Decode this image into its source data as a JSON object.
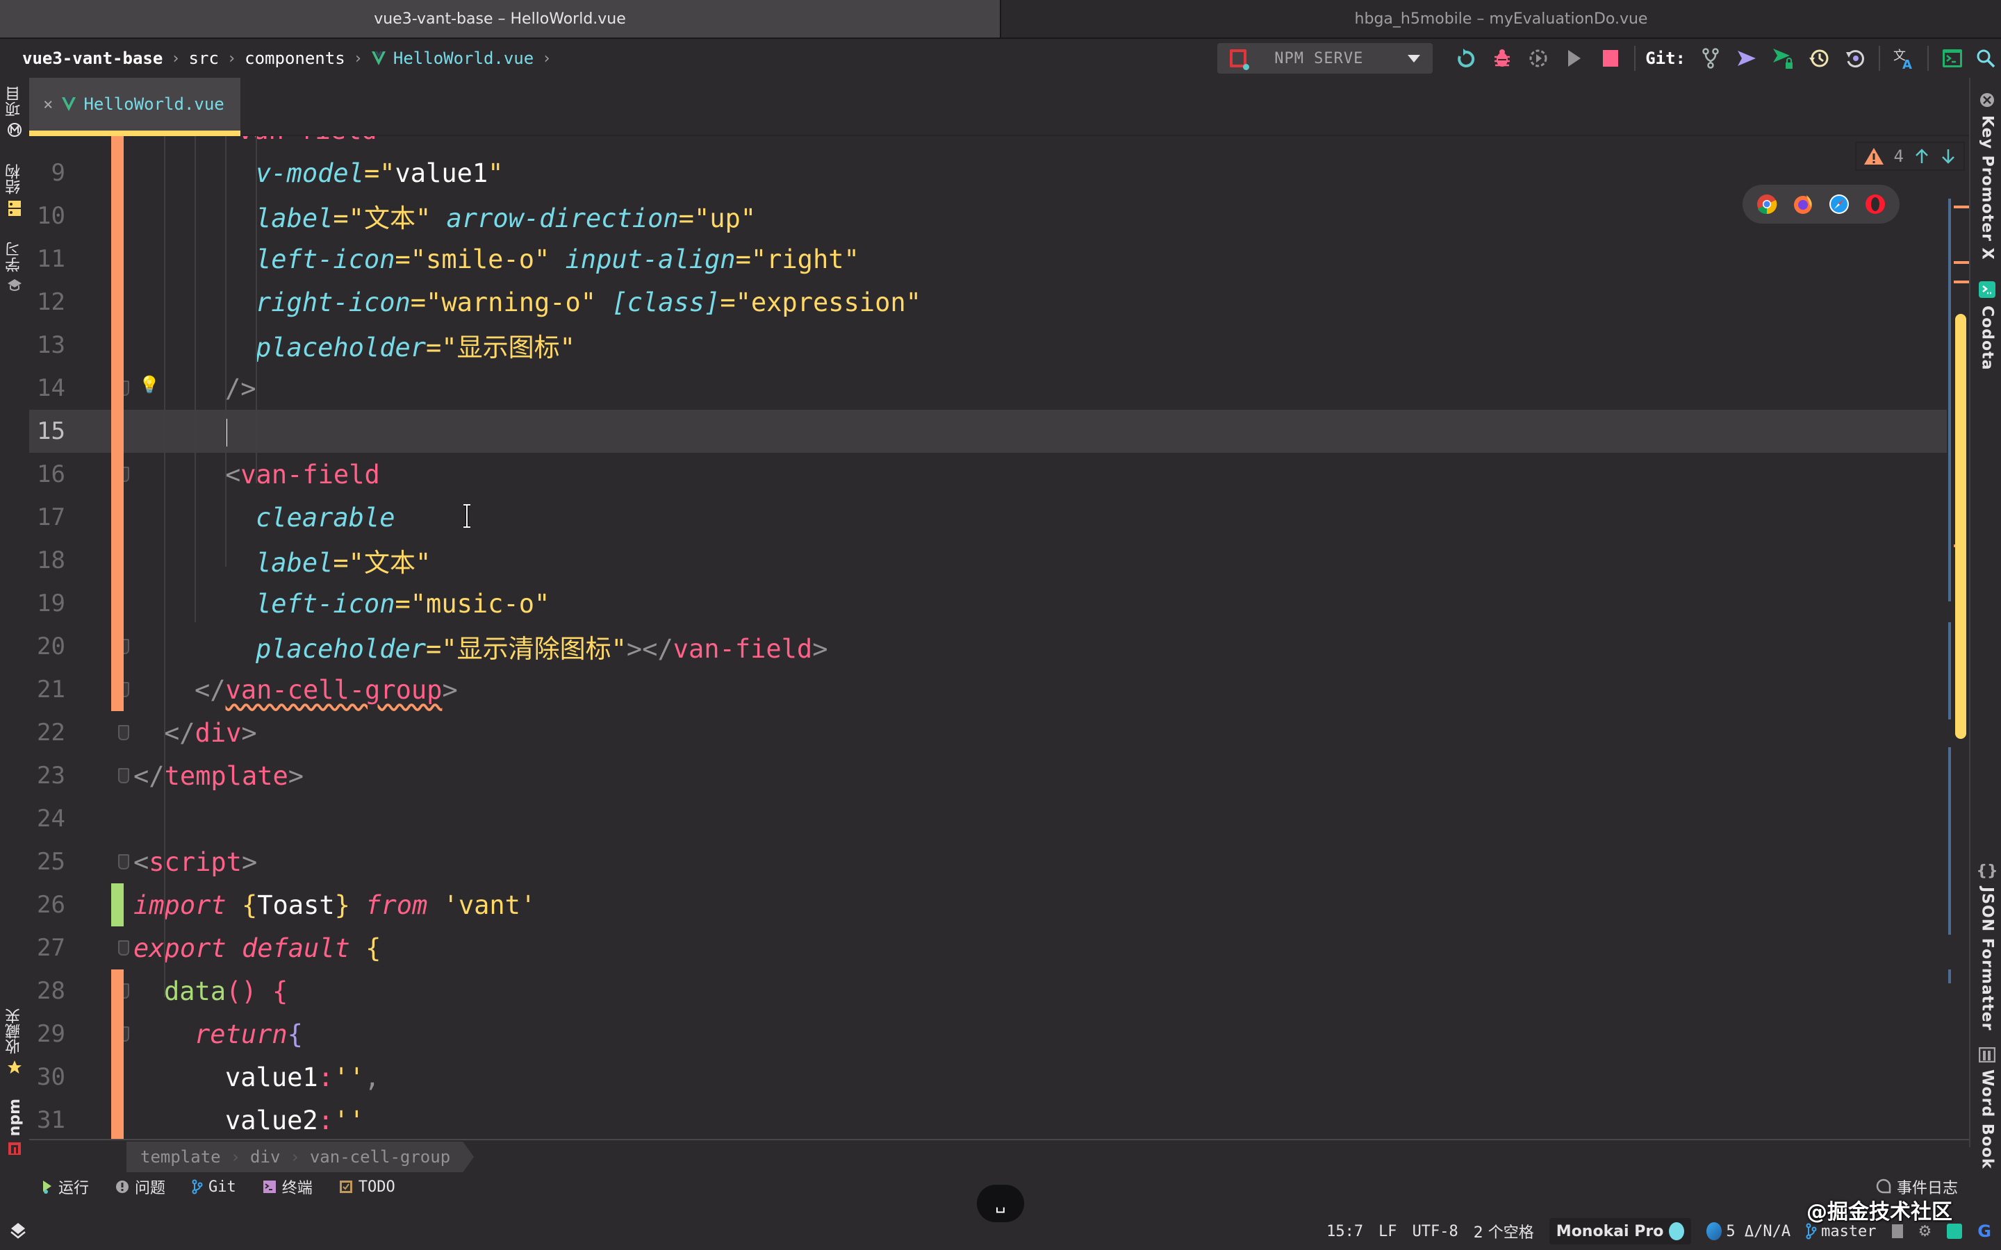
{
  "window_tabs": [
    {
      "title": "vue3-vant-base – HelloWorld.vue",
      "active": true
    },
    {
      "title": "hbga_h5mobile – myEvaluationDo.vue",
      "active": false
    }
  ],
  "breadcrumb": {
    "items": [
      "vue3-vant-base",
      "src",
      "components",
      "HelloWorld.vue"
    ]
  },
  "toolbar": {
    "run_config": "NPM SERVE",
    "git_label": "Git:",
    "icons": [
      "rerun-icon",
      "debug-icon",
      "coverage-icon",
      "run-icon",
      "stop-icon",
      "git-branch-icon",
      "git-push-icon",
      "git-commit-icon",
      "git-history-icon",
      "git-rollback-icon",
      "translate-icon",
      "terminal-icon",
      "search-icon"
    ]
  },
  "left_strip": {
    "top": [
      {
        "label": "项目",
        "icon": "project-icon"
      },
      {
        "label": "结构",
        "icon": "structure-icon"
      },
      {
        "label": "学习",
        "icon": "learn-icon"
      }
    ],
    "bottom": [
      {
        "label": "收藏夹",
        "icon": "star-icon"
      },
      {
        "label": "npm",
        "icon": "npm-icon"
      }
    ]
  },
  "right_strip": [
    {
      "label": "Key Promoter X",
      "icon": "key-promoter-icon"
    },
    {
      "label": "Codota",
      "icon": "codota-icon"
    },
    {
      "label": "JSON Formatter",
      "icon": "braces-icon"
    },
    {
      "label": "Word Book",
      "icon": "book-icon"
    }
  ],
  "editor_tab": {
    "label": "HelloWorld.vue",
    "close": "×"
  },
  "inspections": {
    "warnings": "4"
  },
  "browsers": [
    "chrome",
    "firefox",
    "safari",
    "opera"
  ],
  "editor": {
    "partial_top_line": "van-field",
    "lines": [
      {
        "n": "9",
        "tokens": [
          [
            "attr",
            "v-model"
          ],
          [
            "eq",
            "="
          ],
          [
            "str",
            "\""
          ],
          [
            "id",
            "value1"
          ],
          [
            "str",
            "\""
          ]
        ],
        "indent": 4
      },
      {
        "n": "10",
        "tokens": [
          [
            "attr",
            "label"
          ],
          [
            "eq",
            "="
          ],
          [
            "str",
            "\"文本\""
          ],
          [
            "id",
            " "
          ],
          [
            "attr",
            "arrow-direction"
          ],
          [
            "eq",
            "="
          ],
          [
            "str",
            "\"up\""
          ]
        ],
        "indent": 4
      },
      {
        "n": "11",
        "tokens": [
          [
            "attr",
            "left-icon"
          ],
          [
            "eq",
            "="
          ],
          [
            "str",
            "\"smile-o\""
          ],
          [
            "id",
            " "
          ],
          [
            "attr",
            "input-align"
          ],
          [
            "eq",
            "="
          ],
          [
            "str",
            "\"right\""
          ]
        ],
        "indent": 4
      },
      {
        "n": "12",
        "tokens": [
          [
            "attr",
            "right-icon"
          ],
          [
            "eq",
            "="
          ],
          [
            "str",
            "\"warning-o\""
          ],
          [
            "id",
            " "
          ],
          [
            "attr",
            "[class]"
          ],
          [
            "eq",
            "="
          ],
          [
            "str",
            "\"expression\""
          ]
        ],
        "indent": 4
      },
      {
        "n": "13",
        "tokens": [
          [
            "attr",
            "placeholder"
          ],
          [
            "eq",
            "="
          ],
          [
            "str",
            "\"显示图标\""
          ]
        ],
        "indent": 4
      },
      {
        "n": "14",
        "tokens": [
          [
            "punc",
            "/>"
          ]
        ],
        "indent": 3
      },
      {
        "n": "15",
        "tokens": [],
        "indent": 3,
        "current": true
      },
      {
        "n": "16",
        "tokens": [
          [
            "punc",
            "<"
          ],
          [
            "tag",
            "van-field"
          ]
        ],
        "indent": 3
      },
      {
        "n": "17",
        "tokens": [
          [
            "attr",
            "clearable"
          ]
        ],
        "indent": 4
      },
      {
        "n": "18",
        "tokens": [
          [
            "attr",
            "label"
          ],
          [
            "eq",
            "="
          ],
          [
            "str",
            "\"文本\""
          ]
        ],
        "indent": 4
      },
      {
        "n": "19",
        "tokens": [
          [
            "attr",
            "left-icon"
          ],
          [
            "eq",
            "="
          ],
          [
            "str",
            "\"music-o\""
          ]
        ],
        "indent": 4
      },
      {
        "n": "20",
        "tokens": [
          [
            "attr",
            "placeholder"
          ],
          [
            "eq",
            "="
          ],
          [
            "str",
            "\"显示清除图标\""
          ],
          [
            "punc",
            "></"
          ],
          [
            "tag",
            "van-field"
          ],
          [
            "punc",
            ">"
          ]
        ],
        "indent": 4
      },
      {
        "n": "21",
        "tokens": [
          [
            "punc",
            "</"
          ],
          [
            "tag-sq",
            "van-cell-group"
          ],
          [
            "punc",
            ">"
          ]
        ],
        "indent": 2
      },
      {
        "n": "22",
        "tokens": [
          [
            "punc",
            "</"
          ],
          [
            "tag",
            "div"
          ],
          [
            "punc",
            ">"
          ]
        ],
        "indent": 1
      },
      {
        "n": "23",
        "tokens": [
          [
            "punc",
            "</"
          ],
          [
            "tag",
            "template"
          ],
          [
            "punc",
            ">"
          ]
        ],
        "indent": 0
      },
      {
        "n": "24",
        "tokens": [],
        "indent": 0
      },
      {
        "n": "25",
        "tokens": [
          [
            "punc",
            "<"
          ],
          [
            "tag",
            "script"
          ],
          [
            "punc",
            ">"
          ]
        ],
        "indent": 0
      },
      {
        "n": "26",
        "tokens": [
          [
            "kw",
            "import"
          ],
          [
            "id",
            " "
          ],
          [
            "brace",
            "{"
          ],
          [
            "id",
            "Toast"
          ],
          [
            "brace",
            "}"
          ],
          [
            "id",
            " "
          ],
          [
            "kw",
            "from"
          ],
          [
            "id",
            " "
          ],
          [
            "str",
            "'vant'"
          ]
        ],
        "indent": 0
      },
      {
        "n": "27",
        "tokens": [
          [
            "kw",
            "export"
          ],
          [
            "id",
            " "
          ],
          [
            "kw",
            "default"
          ],
          [
            "id",
            " "
          ],
          [
            "brace",
            "{"
          ]
        ],
        "indent": 0
      },
      {
        "n": "28",
        "tokens": [
          [
            "fn",
            "data"
          ],
          [
            "brace2",
            "()"
          ],
          [
            "id",
            " "
          ],
          [
            "brace2",
            "{"
          ]
        ],
        "indent": 1
      },
      {
        "n": "29",
        "tokens": [
          [
            "kw",
            "return"
          ],
          [
            "brace3",
            "{"
          ]
        ],
        "indent": 2
      },
      {
        "n": "30",
        "tokens": [
          [
            "id",
            "value1"
          ],
          [
            "tag",
            ":"
          ],
          [
            "str",
            "''"
          ],
          [
            "punc",
            ","
          ]
        ],
        "indent": 3
      },
      {
        "n": "31",
        "tokens": [
          [
            "id",
            "value2"
          ],
          [
            "tag",
            ":"
          ],
          [
            "str",
            "''"
          ]
        ],
        "indent": 3
      }
    ]
  },
  "footer_breadcrumb": [
    "template",
    "div",
    "van-cell-group"
  ],
  "tool_tabs": [
    {
      "label": "运行",
      "icon": "run-icon"
    },
    {
      "label": "问题",
      "icon": "problems-icon"
    },
    {
      "label": "Git",
      "icon": "git-icon"
    },
    {
      "label": "终端",
      "icon": "terminal-icon"
    },
    {
      "label": "TODO",
      "icon": "todo-icon"
    }
  ],
  "event_log": "事件日志",
  "key_hint": "␣",
  "status": {
    "position": "15:7",
    "line_ending": "LF",
    "encoding": "UTF-8",
    "indent": "2 个空格",
    "theme": "Monokai Pro",
    "vcs_info": "5 Δ/N/A",
    "branch": "master"
  },
  "watermark": "@掘金技术社区",
  "colors": {
    "background": "#2d2a2e",
    "tag": "#ff6188",
    "attribute": "#78dce8",
    "string": "#ffd866",
    "function": "#a9dc76",
    "modified": "#fc9867",
    "added": "#a9dc76"
  }
}
